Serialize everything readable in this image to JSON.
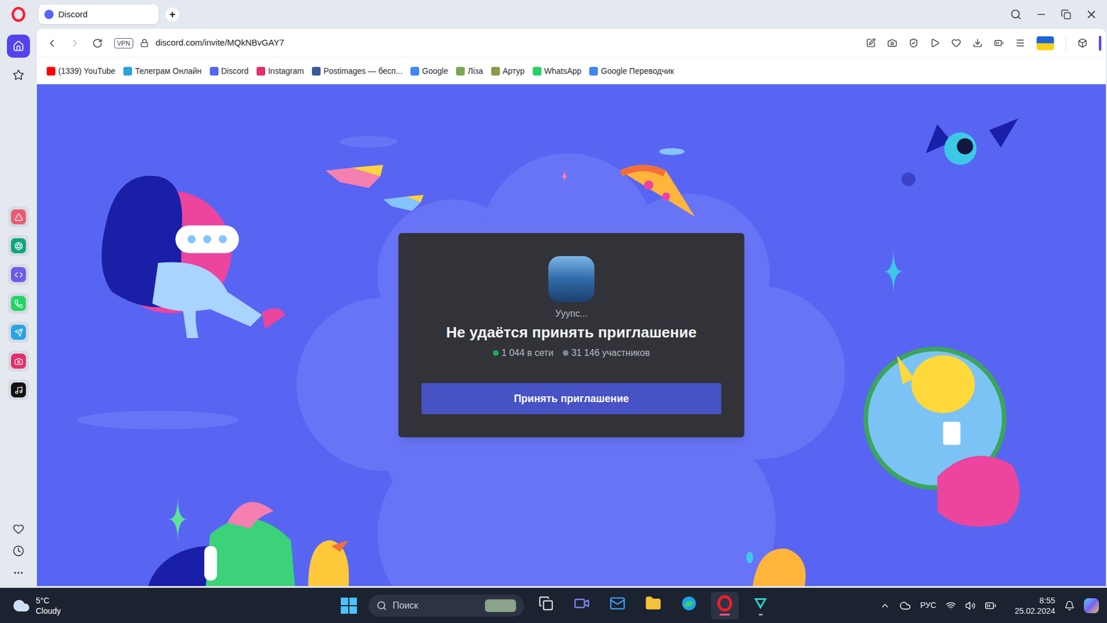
{
  "browser": {
    "tabs": [
      {
        "label": "Discord",
        "selected": true
      }
    ],
    "new_tab": "+",
    "vpn": "VPN",
    "url": "discord.com/invite/MQkNBvGAY7",
    "bookmarks": [
      {
        "label": "(1339) YouTube",
        "color": "#ff0000"
      },
      {
        "label": "Телеграм Онлайн",
        "color": "#2aa3e0"
      },
      {
        "label": "Discord",
        "color": "#5865f2"
      },
      {
        "label": "Instagram",
        "color": "#e1306c"
      },
      {
        "label": "Postimages — бесп...",
        "color": "#3b5998"
      },
      {
        "label": "Google",
        "color": "#4285f4"
      },
      {
        "label": "Ліза",
        "color": "#7aa85a"
      },
      {
        "label": "Артур",
        "color": "#8a9a4a"
      },
      {
        "label": "WhatsApp",
        "color": "#25d366"
      },
      {
        "label": "Google Переводчик",
        "color": "#4285f4"
      }
    ]
  },
  "sidebar": {
    "nav": [
      {
        "kind": "home",
        "selected": true
      },
      {
        "kind": "favorites",
        "selected": false
      }
    ],
    "apps": [
      {
        "kind": "aria",
        "color": "#e85d75"
      },
      {
        "kind": "chatgpt",
        "color": "#10a37f"
      },
      {
        "kind": "cs",
        "color": "#6c5ce7"
      },
      {
        "kind": "whatsapp",
        "color": "#25d366"
      },
      {
        "kind": "telegram",
        "color": "#2aa3e0"
      },
      {
        "kind": "instagram",
        "color": "#e1306c"
      },
      {
        "kind": "tiktok",
        "color": "#111111"
      }
    ]
  },
  "invite": {
    "status": "Ууупс...",
    "title": "Не удаётся принять приглашение",
    "stats": [
      {
        "label": "1 044 в сети",
        "color": "#23a55a"
      },
      {
        "label": "31 146 участников",
        "color": "#80848e"
      }
    ],
    "button": "Принять приглашение"
  },
  "taskbar": {
    "weather": {
      "temperature": "5°C",
      "condition": "Cloudy"
    },
    "search": {
      "placeholder": "Поиск"
    },
    "apps": [
      {
        "kind": "task-view",
        "running": false,
        "active": false
      },
      {
        "kind": "meet",
        "running": false,
        "active": false
      },
      {
        "kind": "mail",
        "running": false,
        "active": false
      },
      {
        "kind": "explorer",
        "running": false,
        "active": false
      },
      {
        "kind": "edge",
        "running": false,
        "active": false
      },
      {
        "kind": "opera",
        "running": true,
        "active": true
      },
      {
        "kind": "other",
        "running": true,
        "active": false
      }
    ],
    "language": "РУС",
    "time": "8:55",
    "date": "25.02.2024"
  }
}
